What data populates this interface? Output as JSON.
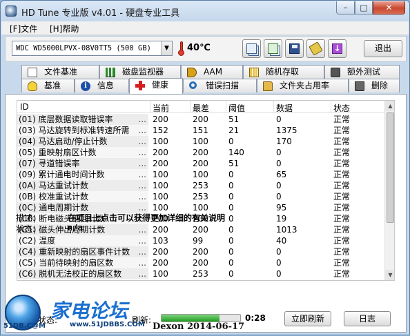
{
  "window": {
    "title": "HD Tune 专业版 v4.01 - 硬盘专业工具",
    "minimize": "–",
    "maximize": "□",
    "close": "✕"
  },
  "menu": {
    "file": "[F]文件",
    "help": "[H]帮助"
  },
  "toolbar": {
    "drive": "WDC WD5000LPVX-08V0TT5   (500 GB)",
    "temperature": "40℃",
    "exit_label": "退出",
    "buttons": [
      "copy-text-icon",
      "copy-screenshot-icon",
      "save-icon",
      "options-icon",
      "download-icon"
    ]
  },
  "tabs": {
    "top": [
      {
        "label": "文件基准",
        "icon": "document-icon"
      },
      {
        "label": "磁盘监视器",
        "icon": "bar-chart-icon"
      },
      {
        "label": "AAM",
        "icon": "speaker-icon"
      },
      {
        "label": "随机存取",
        "icon": "grid-icon"
      },
      {
        "label": "额外测试",
        "icon": "tower-icon"
      }
    ],
    "bottom": [
      {
        "label": "基准",
        "icon": "lightbulb-icon"
      },
      {
        "label": "信息",
        "icon": "info-icon"
      },
      {
        "label": "健康",
        "icon": "red-cross-icon",
        "active": true
      },
      {
        "label": "错误扫描",
        "icon": "magnifier-icon"
      },
      {
        "label": "文件夹占用率",
        "icon": "folder-icon"
      },
      {
        "label": "删除",
        "icon": "trash-icon"
      }
    ]
  },
  "health": {
    "columns": [
      "ID",
      "当前",
      "最差",
      "阈值",
      "数据",
      "状态"
    ],
    "rows": [
      {
        "id": "(01) 底层数据读取错误率",
        "current": "200",
        "worst": "200",
        "threshold": "51",
        "data": "0",
        "status": "正常"
      },
      {
        "id": "(03) 马达旋转到标准转速所需",
        "current": "152",
        "worst": "151",
        "threshold": "21",
        "data": "1375",
        "status": "正常"
      },
      {
        "id": "(04) 马达启动/停止计数",
        "current": "100",
        "worst": "100",
        "threshold": "0",
        "data": "170",
        "status": "正常"
      },
      {
        "id": "(05) 重映射扇区计数",
        "current": "200",
        "worst": "200",
        "threshold": "140",
        "data": "0",
        "status": "正常"
      },
      {
        "id": "(07) 寻道错误率",
        "current": "200",
        "worst": "200",
        "threshold": "51",
        "data": "0",
        "status": "正常"
      },
      {
        "id": "(09) 累计通电时间计数",
        "current": "100",
        "worst": "100",
        "threshold": "0",
        "data": "65",
        "status": "正常"
      },
      {
        "id": "(0A) 马达重试计数",
        "current": "100",
        "worst": "253",
        "threshold": "0",
        "data": "0",
        "status": "正常"
      },
      {
        "id": "(0B) 校准重试计数",
        "current": "100",
        "worst": "253",
        "threshold": "0",
        "data": "0",
        "status": "正常"
      },
      {
        "id": "(0C) 通电周期计数",
        "current": "100",
        "worst": "100",
        "threshold": "0",
        "data": "95",
        "status": "正常"
      },
      {
        "id": "(C0) 断电磁头缩回计数",
        "current": "200",
        "worst": "200",
        "threshold": "0",
        "data": "19",
        "status": "正常"
      },
      {
        "id": "(C1) 磁头伸出周期计数",
        "current": "200",
        "worst": "200",
        "threshold": "0",
        "data": "1013",
        "status": "正常"
      },
      {
        "id": "(C2) 温度",
        "current": "103",
        "worst": "99",
        "threshold": "0",
        "data": "40",
        "status": "正常"
      },
      {
        "id": "(C4) 重新映射的扇区事件计数",
        "current": "200",
        "worst": "200",
        "threshold": "0",
        "data": "0",
        "status": "正常"
      },
      {
        "id": "(C5) 当前待映射的扇区数",
        "current": "200",
        "worst": "200",
        "threshold": "0",
        "data": "0",
        "status": "正常"
      },
      {
        "id": "(C6) 脱机无法校正的扇区数",
        "current": "100",
        "worst": "253",
        "threshold": "0",
        "data": "0",
        "status": "正常"
      }
    ],
    "dots": "...",
    "description_label": "描述:",
    "description": "在项目上点击可以获得更加详细的有关说明",
    "status_label": "状态:",
    "status_value": "n/a"
  },
  "footer": {
    "health_label": "健康状态:",
    "refresh_label": "刷新:",
    "refresh_progress": 0.74,
    "timer": "0:28",
    "refresh_now": "立即刷新",
    "log": "日志"
  },
  "watermark": {
    "logo_text": "家电论坛",
    "sub": "51DB.C@M",
    "url": "www.51JDBBS.COM"
  },
  "signature": "Dexon  2014-06-17",
  "colors": {
    "window_frame": "#c9d9ec",
    "close_button": "#c9482f",
    "progress_fill": "#1f9d1f",
    "health_cross": "#d61e1e"
  }
}
